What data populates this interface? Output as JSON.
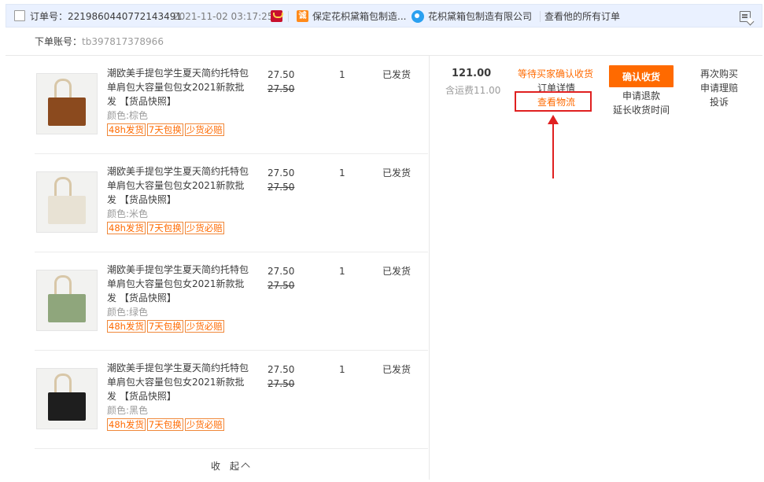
{
  "header": {
    "order_no_label": "订单号：2219860440772143491",
    "order_date": "2021-11-02 03:17:25",
    "shop_name": "保定花枳黛箱包制造...",
    "company": "花枳黛箱包制造有限公司",
    "all_orders": "查看他的所有订单",
    "cheng_glyph": "诚",
    "icons": [
      "tmall-icon",
      "cheng-icon",
      "wangwang-icon",
      "delete-order-icon"
    ]
  },
  "account": {
    "label": "下单账号：",
    "value": "tb397817378966"
  },
  "items": [
    {
      "title": "潮欧美手提包学生夏天简约托特包单肩包大容量包包女2021新款批发",
      "snapshot": "【货品快照】",
      "color": "颜色:棕色",
      "price": "27.50",
      "original_price": "27.50",
      "quantity": "1",
      "status": "已发货",
      "badges": [
        "48h发货",
        "7天包换",
        "少货必赔"
      ],
      "image_color": "#8b4a1e"
    },
    {
      "title": "潮欧美手提包学生夏天简约托特包单肩包大容量包包女2021新款批发",
      "snapshot": "【货品快照】",
      "color": "颜色:米色",
      "price": "27.50",
      "original_price": "27.50",
      "quantity": "1",
      "status": "已发货",
      "badges": [
        "48h发货",
        "7天包换",
        "少货必赔"
      ],
      "image_color": "#e8e2d4"
    },
    {
      "title": "潮欧美手提包学生夏天简约托特包单肩包大容量包包女2021新款批发",
      "snapshot": "【货品快照】",
      "color": "颜色:绿色",
      "price": "27.50",
      "original_price": "27.50",
      "quantity": "1",
      "status": "已发货",
      "badges": [
        "48h发货",
        "7天包换",
        "少货必赔"
      ],
      "image_color": "#8fa67c"
    },
    {
      "title": "潮欧美手提包学生夏天简约托特包单肩包大容量包包女2021新款批发",
      "snapshot": "【货品快照】",
      "color": "颜色:黑色",
      "price": "27.50",
      "original_price": "27.50",
      "quantity": "1",
      "status": "已发货",
      "badges": [
        "48h发货",
        "7天包换",
        "少货必赔"
      ],
      "image_color": "#1e1e1e"
    }
  ],
  "collapse_label": "收　起",
  "summary": {
    "total": "121.00",
    "shipping": "含运费11.00"
  },
  "status_col": {
    "waiting": "等待买家确认收货",
    "detail": "订单详情",
    "logistics": "查看物流",
    "extend": "延长收货时间"
  },
  "actions": {
    "confirm": "确认收货",
    "refund": "申请退款"
  },
  "more": {
    "rebuy": "再次购买",
    "claim": "申请理赔",
    "complain": "投诉"
  },
  "colors": {
    "accent_orange": "#ff6a00",
    "highlight_red": "#e02020",
    "header_bg": "#eaf1ff"
  }
}
